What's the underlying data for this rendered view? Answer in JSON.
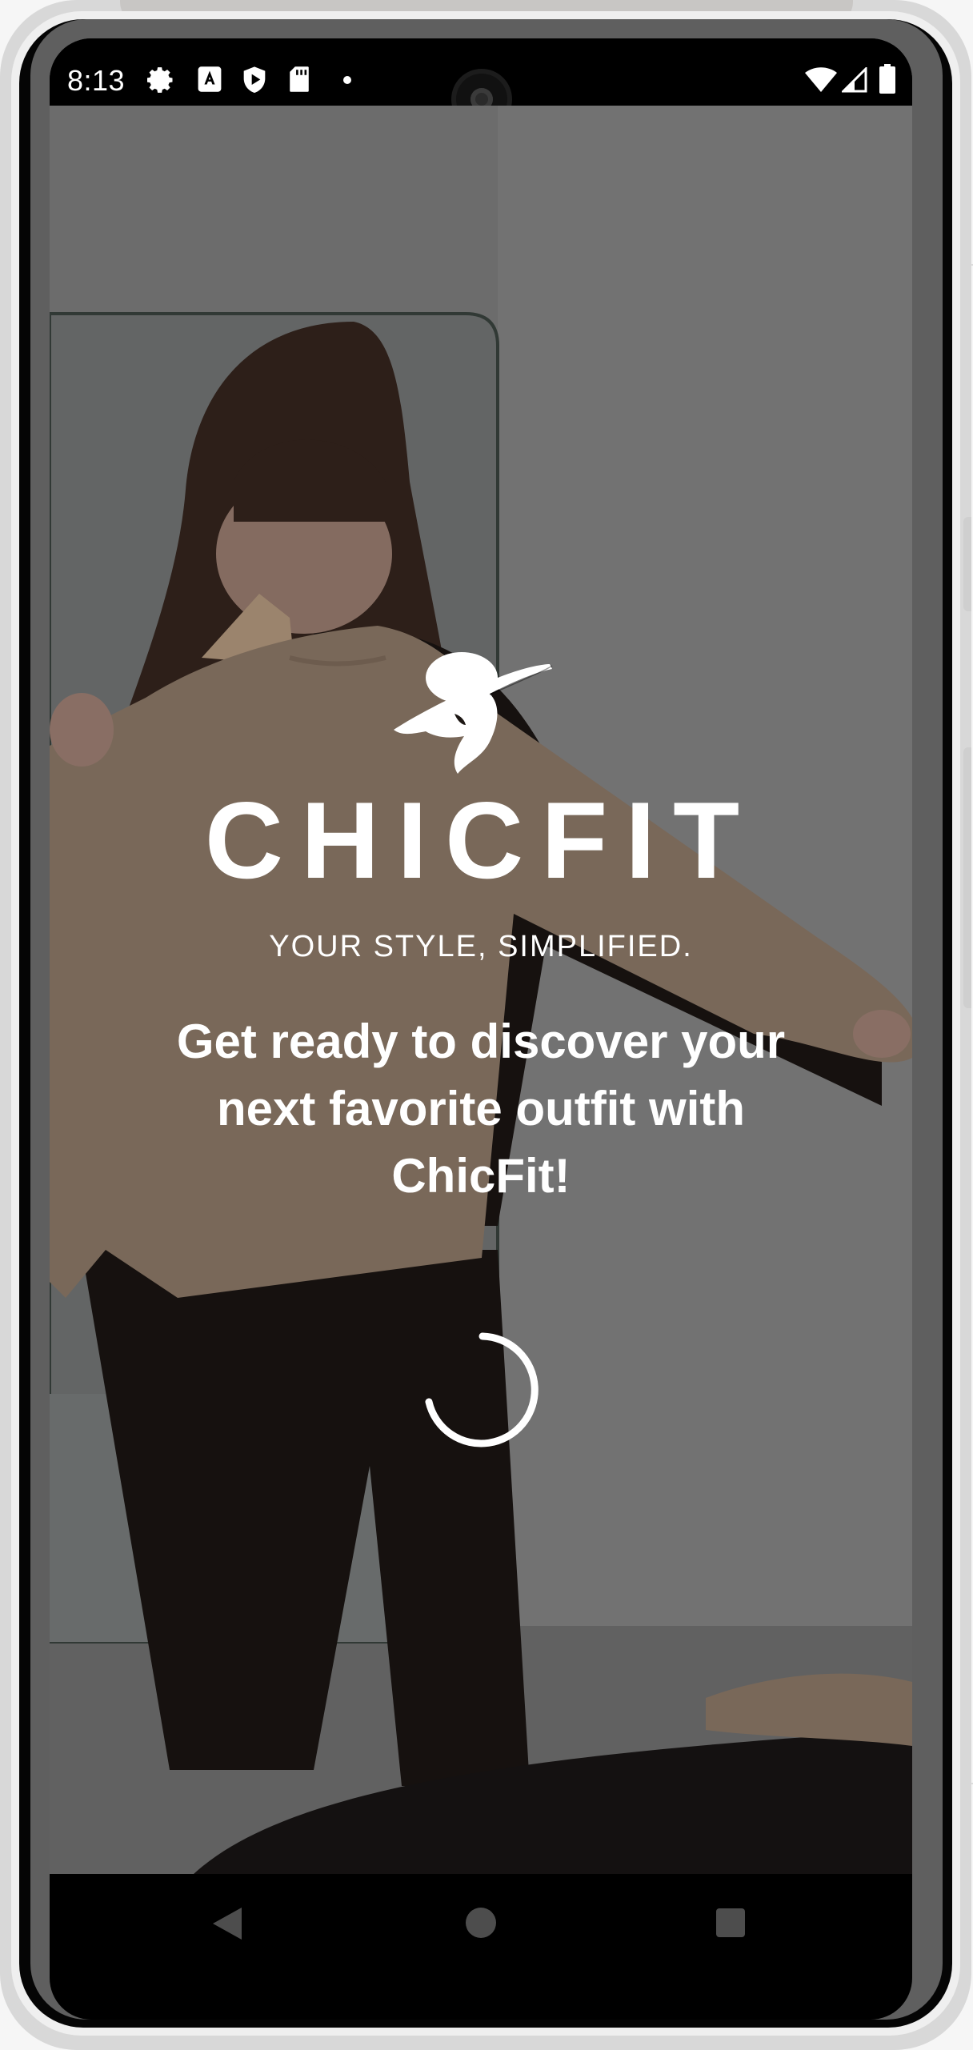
{
  "status_bar": {
    "time": "8:13",
    "left_icons": [
      "gear-icon",
      "keyboard-a-icon",
      "shield-play-icon",
      "sd-card-icon",
      "dot-icon"
    ],
    "right_icons": [
      "wifi-icon",
      "signal-icon",
      "battery-icon"
    ]
  },
  "splash": {
    "logo_icon": "woman-with-hat-icon",
    "brand_name": "CHICFIT",
    "tagline": "YOUR STYLE, SIMPLIFIED.",
    "welcome_message": "Get ready to discover your next favorite outfit with ChicFit!",
    "loading_indicator": "spinner-icon"
  },
  "navigation_bar": {
    "buttons": [
      "back-icon",
      "home-icon",
      "recents-icon"
    ]
  },
  "colors": {
    "overlay_text": "#ffffff",
    "status_bar_bg": "#000000",
    "sweater": "#9b8673",
    "pants": "#1d1714",
    "wall": "#8c8c8c"
  }
}
